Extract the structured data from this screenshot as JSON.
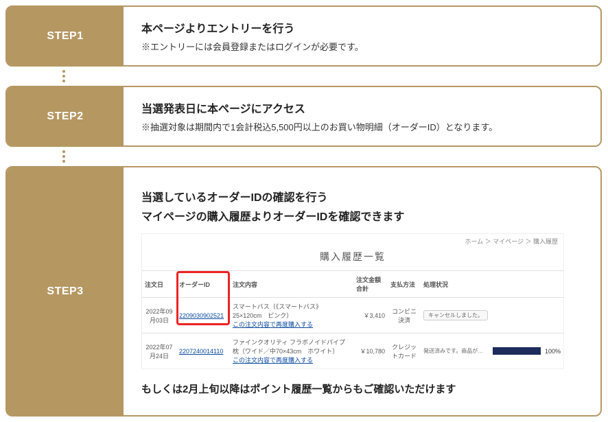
{
  "steps": {
    "s1": {
      "label": "STEP1",
      "title": "本ページよりエントリーを行う",
      "sub": "※エントリーには会員登録またはログインが必要です。"
    },
    "s2": {
      "label": "STEP2",
      "title": "当選発表日に本ページにアクセス",
      "sub": "※抽選対象は期間内で1会計税込5,500円以上のお買い物明細（オーダーID）となります。"
    },
    "s3": {
      "label": "STEP3",
      "title": "当選しているオーダーIDの確認を行う",
      "line2": "マイページの購入履歴よりオーダーIDを確認できます",
      "footer": "もしくは2月上旬以降はポイント履歴一覧からもご確認いただけます"
    }
  },
  "inner": {
    "crumb": "ホーム ＞ マイページ ＞ 購入履歴",
    "heading": "購入履歴一覧",
    "headers": {
      "date": "注文日",
      "id": "オーダーID",
      "desc": "注文内容",
      "total": "注文金額合計",
      "pay": "支払方法",
      "status": "処理状況"
    },
    "rows": [
      {
        "date": "2022年09月03日",
        "id": "2209030902521",
        "desc_name": "スマートバス（《スマートバス》25×120cm　ピンク）",
        "desc_link": "この注文内容で再度購入する",
        "total": "￥3,410",
        "pay": "コンビニ決済",
        "status_type": "cancel",
        "status_text": "キャンセルしました。"
      },
      {
        "date": "2022年07月24日",
        "id": "2207240014110",
        "desc_name": "ファインクオリティ フラボノイドパイプ枕（ワイド／中70×43cm　ホワイト）",
        "desc_link": "この注文内容で再度購入する",
        "total": "￥10,780",
        "pay": "クレジットカード",
        "status_type": "progress",
        "status_text": "発送済みです。商品が届きましたら受け取りボタンを押してください。",
        "pct": "100%"
      }
    ]
  }
}
